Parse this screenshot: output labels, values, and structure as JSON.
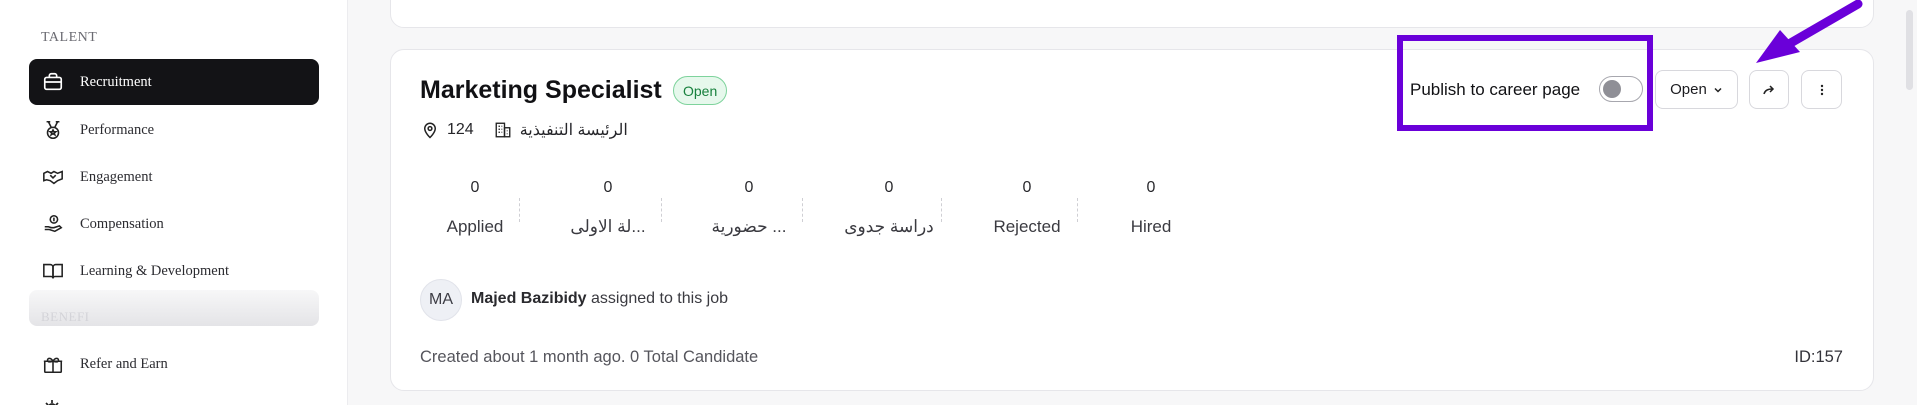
{
  "sidebar": {
    "section_label": "TALENT",
    "items": [
      {
        "label": "Recruitment",
        "icon": "briefcase-icon",
        "active": true
      },
      {
        "label": "Performance",
        "icon": "medal-icon",
        "active": false
      },
      {
        "label": "Engagement",
        "icon": "handshake-icon",
        "active": false
      },
      {
        "label": "Compensation",
        "icon": "hand-coin-icon",
        "active": false
      },
      {
        "label": "Learning & Development",
        "icon": "book-icon",
        "active": false
      },
      {
        "label": "Refer and Earn",
        "icon": "gift-icon",
        "active": false
      }
    ],
    "faded_label": "BENEFI"
  },
  "job": {
    "title": "Marketing Specialist",
    "status": "Open",
    "location": "124",
    "department": "الرئيسة التنفيذية",
    "stages": [
      {
        "count": "0",
        "label": "Applied"
      },
      {
        "count": "0",
        "label": "...لة الاولى"
      },
      {
        "count": "0",
        "label": "... حضورية"
      },
      {
        "count": "0",
        "label": "دراسة جدوى"
      },
      {
        "count": "0",
        "label": "Rejected"
      },
      {
        "count": "0",
        "label": "Hired"
      }
    ],
    "assignee_initials": "MA",
    "assignee_name": "Majed Bazibidy",
    "assignee_suffix": " assigned to this job",
    "created_text": "Created about 1 month ago. 0 Total Candidate",
    "id_text": "ID:157",
    "publish_label": "Publish to career page",
    "publish_enabled": false,
    "status_dropdown": "Open"
  },
  "colors": {
    "accent_annotation": "#6a00d9",
    "active_nav_bg": "#131316",
    "badge_green": "#17803d"
  }
}
